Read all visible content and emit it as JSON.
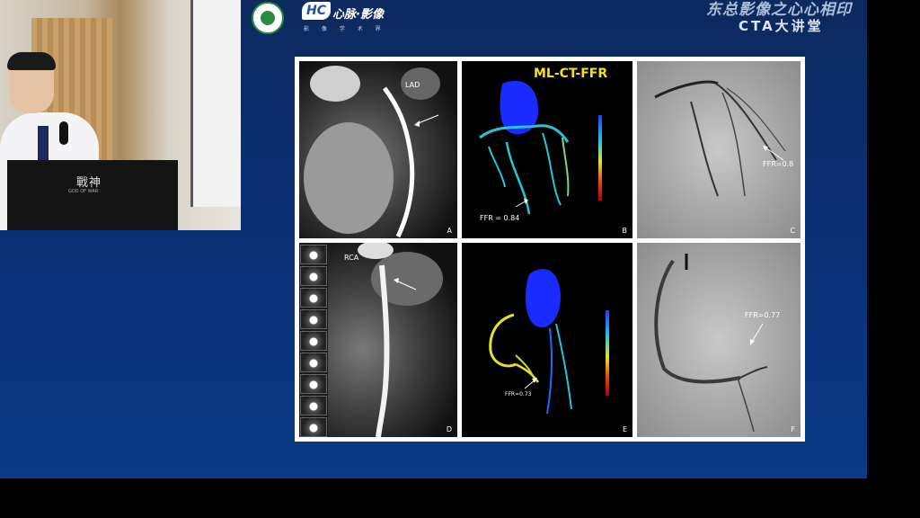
{
  "header": {
    "brand_name": "心脉·影像",
    "brand_sub": "影 像 学 术 界",
    "title_line1": "东总影像之心心相印",
    "title_line2": "CTA大讲堂"
  },
  "video": {
    "podium_logo": "戰神",
    "podium_sub": "GOD OF WAR"
  },
  "figure": {
    "title": "ML-CT-FFR",
    "panels": {
      "A": {
        "letter": "A",
        "vessel": "LAD"
      },
      "B": {
        "letter": "B",
        "ffr": "FFR = 0.84"
      },
      "C": {
        "letter": "C",
        "ffr": "FFR=0.8"
      },
      "D": {
        "letter": "D",
        "vessel": "RCA"
      },
      "E": {
        "letter": "E",
        "ffr": "FFR=0.73"
      },
      "F": {
        "letter": "F",
        "ffr": "FFR=0.77"
      }
    },
    "colorbar": [
      "#1f3bff",
      "#23c7d9",
      "#e0e620",
      "#e53a14",
      "#b10000"
    ]
  }
}
